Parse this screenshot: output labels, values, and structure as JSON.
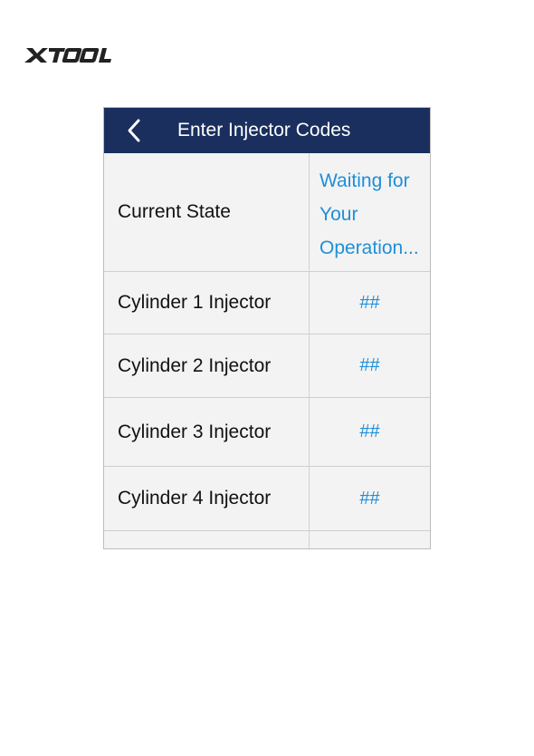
{
  "brand": {
    "logo_text": "XTOOL"
  },
  "header": {
    "title": "Enter Injector Codes",
    "back_icon": "chevron-left-icon",
    "background": "#1a2f5e"
  },
  "table": {
    "state_label": "Current State",
    "state_value": "Waiting for\nYour\nOperation...",
    "rows": [
      {
        "label": "Cylinder 1 Injector",
        "value": "##"
      },
      {
        "label": "Cylinder 2 Injector",
        "value": "##"
      },
      {
        "label": "Cylinder 3 Injector",
        "value": "##"
      },
      {
        "label": "Cylinder 4 Injector",
        "value": "##"
      }
    ]
  },
  "colors": {
    "accent": "#1f8fd8",
    "header": "#1a2f5e",
    "panel": "#f3f3f3"
  }
}
